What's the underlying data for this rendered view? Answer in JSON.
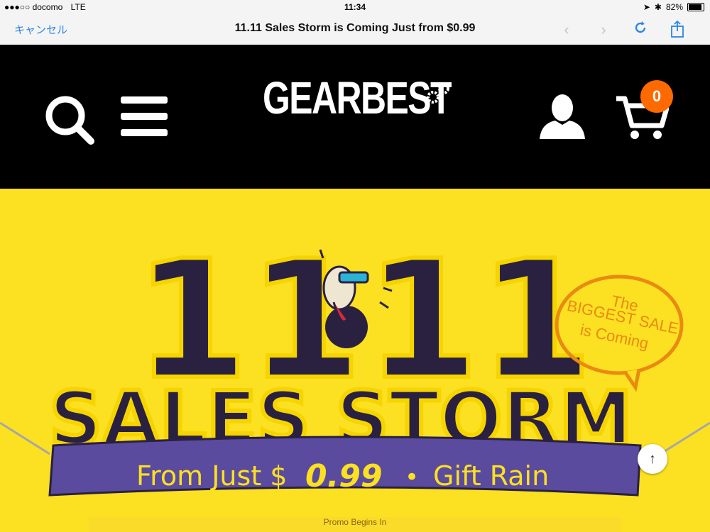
{
  "status_bar": {
    "carrier": "●●●○○ docomo",
    "network": "LTE",
    "time": "11:34",
    "battery_text": "82%",
    "battery_level": 0.82
  },
  "nav": {
    "cancel_label": "キャンセル",
    "title": "11.11 Sales Storm is Coming Just from $0.99",
    "icons": [
      "back-icon",
      "forward-icon",
      "reload-icon",
      "share-icon"
    ]
  },
  "site_header": {
    "logo_text": "GEARBEST",
    "cart_count": "0",
    "icons": [
      "search-icon",
      "menu-icon",
      "account-icon",
      "cart-icon"
    ]
  },
  "banner": {
    "big_number_left": "11",
    "big_number_right": "11",
    "headline": "SALES STORM",
    "bubble_line1": "The",
    "bubble_line2": "BIGGEST SALE",
    "bubble_line3": "is Coming",
    "ribbon_part1": "From Just $",
    "ribbon_price": "0.99",
    "ribbon_dot": "•",
    "ribbon_part2": "Gift Rain",
    "promo_text": "Promo Begins In"
  },
  "colors": {
    "banner_bg": "#fce022",
    "ribbon": "#5a4b9e",
    "cart_badge": "#ff6a00",
    "ios_blue": "#2b86e6"
  }
}
